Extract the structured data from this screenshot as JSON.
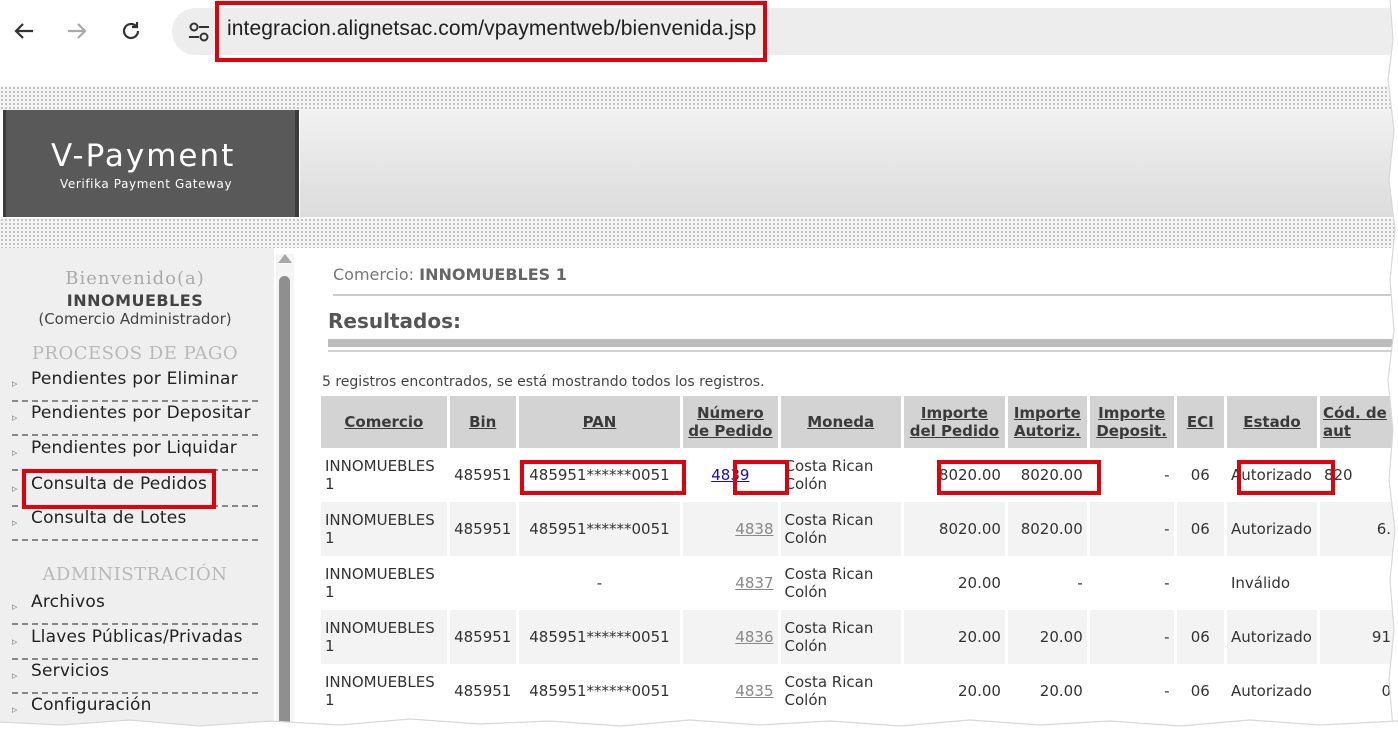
{
  "browser": {
    "url": "integracion.alignetsac.com/vpaymentweb/bienvenida.jsp"
  },
  "logo": {
    "title": "V-Payment",
    "subtitle": "Verifika Payment Gateway"
  },
  "sidebar": {
    "welcome": "Bienvenido(a)",
    "merchant": "INNOMUEBLES",
    "role": "(Comercio Administrador)",
    "sections": [
      {
        "title": "PROCESOS DE PAGO",
        "items": [
          "Pendientes por Eliminar",
          "Pendientes por Depositar",
          "Pendientes por Liquidar",
          "Consulta de Pedidos",
          "Consulta de Lotes"
        ]
      },
      {
        "title": "ADMINISTRACIÓN",
        "items": [
          "Archivos",
          "Llaves Públicas/Privadas",
          "Servicios",
          "Configuración"
        ]
      }
    ]
  },
  "main": {
    "comercio_label": "Comercio:",
    "comercio_value": "INNOMUEBLES 1",
    "results_title": "Resultados:",
    "count_text": "5 registros encontrados, se está mostrando todos los registros.",
    "columns": [
      "Comercio",
      "Bin",
      "PAN",
      "Número de Pedido",
      "Moneda",
      "Importe del Pedido",
      "Importe Autoriz.",
      "Importe Deposit.",
      "ECI",
      "Estado",
      "Cód. de aut"
    ],
    "rows": [
      {
        "comercio": "INNOMUEBLES 1",
        "bin": "485951",
        "pan": "485951******0051",
        "pedido": "4839",
        "moneda": "Costa Rican Colón",
        "importe_pedido": "8020.00",
        "importe_autoriz": "8020.00",
        "importe_deposit": "-",
        "eci": "06",
        "estado": "Autorizado",
        "cod": "820"
      },
      {
        "comercio": "INNOMUEBLES 1",
        "bin": "485951",
        "pan": "485951******0051",
        "pedido": "4838",
        "moneda": "Costa Rican Colón",
        "importe_pedido": "8020.00",
        "importe_autoriz": "8020.00",
        "importe_deposit": "-",
        "eci": "06",
        "estado": "Autorizado",
        "cod": "6."
      },
      {
        "comercio": "INNOMUEBLES 1",
        "bin": "",
        "pan": "-",
        "pedido": "4837",
        "moneda": "Costa Rican Colón",
        "importe_pedido": "20.00",
        "importe_autoriz": "-",
        "importe_deposit": "-",
        "eci": "",
        "estado": "Inválido",
        "cod": ""
      },
      {
        "comercio": "INNOMUEBLES 1",
        "bin": "485951",
        "pan": "485951******0051",
        "pedido": "4836",
        "moneda": "Costa Rican Colón",
        "importe_pedido": "20.00",
        "importe_autoriz": "20.00",
        "importe_deposit": "-",
        "eci": "06",
        "estado": "Autorizado",
        "cod": "91"
      },
      {
        "comercio": "INNOMUEBLES 1",
        "bin": "485951",
        "pan": "485951******0051",
        "pedido": "4835",
        "moneda": "Costa Rican Colón",
        "importe_pedido": "20.00",
        "importe_autoriz": "20.00",
        "importe_deposit": "-",
        "eci": "06",
        "estado": "Autorizado",
        "cod": "0"
      }
    ]
  },
  "colors": {
    "highlight": "#e0000b",
    "logo_bg": "#595959",
    "link_active": "#1a0dab"
  }
}
